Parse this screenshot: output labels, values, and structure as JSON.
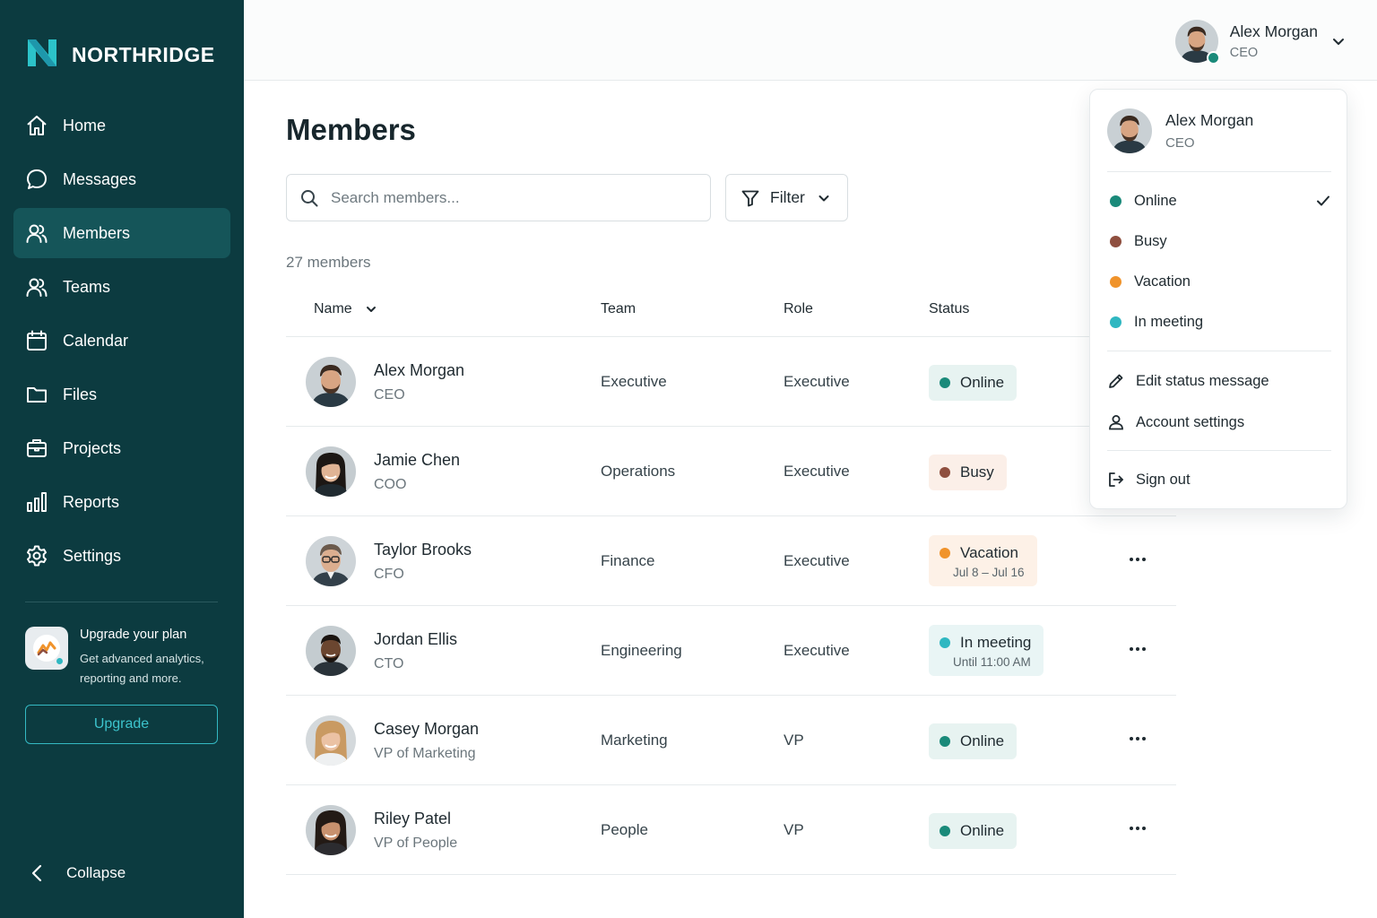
{
  "brand": {
    "name": "NORTHRIDGE",
    "logo_icon": "northridge-logo-icon"
  },
  "colors": {
    "sidebar_bg": "#0c3b40",
    "sidebar_active": "#155559",
    "accent": "#34b9c3",
    "online": "#1a8a7a",
    "busy": "#8f4f3f",
    "vacation": "#f0932b",
    "in_meeting": "#2fb7c1"
  },
  "sidebar": {
    "items": [
      {
        "label": "Home",
        "icon": "home-icon",
        "active": false
      },
      {
        "label": "Messages",
        "icon": "message-icon",
        "active": false
      },
      {
        "label": "Members",
        "icon": "members-icon",
        "active": true
      },
      {
        "label": "Teams",
        "icon": "teams-icon",
        "active": false
      },
      {
        "label": "Calendar",
        "icon": "calendar-icon",
        "active": false
      },
      {
        "label": "Files",
        "icon": "folder-icon",
        "active": false
      },
      {
        "label": "Projects",
        "icon": "briefcase-icon",
        "active": false
      },
      {
        "label": "Reports",
        "icon": "bar-chart-icon",
        "active": false
      },
      {
        "label": "Settings",
        "icon": "gear-icon",
        "active": false
      }
    ],
    "upgrade": {
      "title": "Upgrade your plan",
      "description": "Get advanced analytics, reporting and more.",
      "button": "Upgrade"
    },
    "collapse_label": "Collapse"
  },
  "topbar": {
    "user_name": "Alex Morgan",
    "user_role": "CEO"
  },
  "main": {
    "title": "Members",
    "search_placeholder": "Search members...",
    "filter_label": "Filter",
    "member_count": "27 members",
    "columns": {
      "name": "Name",
      "team": "Team",
      "role": "Role",
      "status": "Status"
    },
    "rows": [
      {
        "name": "Alex Morgan",
        "title": "CEO",
        "team": "Executive",
        "role": "Executive",
        "status": "Online",
        "status_key": "online",
        "status_detail": ""
      },
      {
        "name": "Jamie Chen",
        "title": "COO",
        "team": "Operations",
        "role": "Executive",
        "status": "Busy",
        "status_key": "busy",
        "status_detail": ""
      },
      {
        "name": "Taylor Brooks",
        "title": "CFO",
        "team": "Finance",
        "role": "Executive",
        "status": "Vacation",
        "status_key": "vacation",
        "status_detail": "Jul 8 – Jul 16"
      },
      {
        "name": "Jordan Ellis",
        "title": "CTO",
        "team": "Engineering",
        "role": "Executive",
        "status": "In meeting",
        "status_key": "in_meeting",
        "status_detail": "Until 11:00 AM"
      },
      {
        "name": "Casey Morgan",
        "title": "VP of Marketing",
        "team": "Marketing",
        "role": "VP",
        "status": "Online",
        "status_key": "online",
        "status_detail": ""
      },
      {
        "name": "Riley Patel",
        "title": "VP of People",
        "team": "People",
        "role": "VP",
        "status": "Online",
        "status_key": "online",
        "status_detail": ""
      }
    ]
  },
  "dropdown": {
    "name": "Alex Morgan",
    "role": "CEO",
    "statuses": [
      {
        "label": "Online",
        "key": "online",
        "selected": true
      },
      {
        "label": "Busy",
        "key": "busy",
        "selected": false
      },
      {
        "label": "Vacation",
        "key": "vacation",
        "selected": false
      },
      {
        "label": "In meeting",
        "key": "in_meeting",
        "selected": false
      }
    ],
    "actions": [
      {
        "label": "Edit status message",
        "icon": "pencil-icon"
      },
      {
        "label": "Account settings",
        "icon": "user-icon"
      }
    ],
    "sign_out": {
      "label": "Sign out",
      "icon": "sign-out-icon"
    }
  }
}
